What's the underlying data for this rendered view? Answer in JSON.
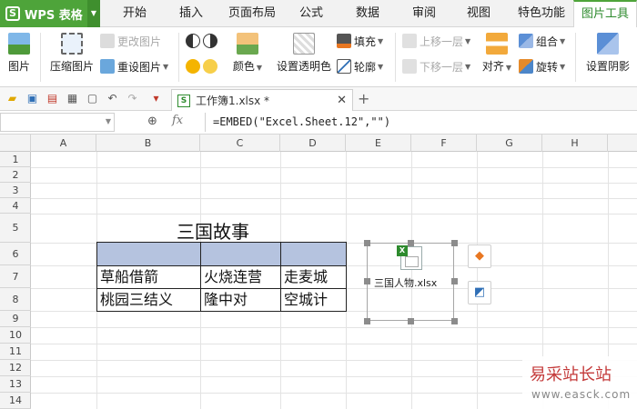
{
  "app": {
    "name": "WPS 表格"
  },
  "ribbon_tabs": [
    {
      "label": "开始"
    },
    {
      "label": "插入"
    },
    {
      "label": "页面布局"
    },
    {
      "label": "公式"
    },
    {
      "label": "数据"
    },
    {
      "label": "审阅"
    },
    {
      "label": "视图"
    },
    {
      "label": "特色功能"
    },
    {
      "label": "图片工具",
      "active": true
    }
  ],
  "ribbon": {
    "picture": "图片",
    "compress": "压缩图片",
    "change_picture": "更改图片",
    "reset_picture": "重设图片",
    "color": "颜色",
    "set_transparent": "设置透明色",
    "fill": "填充",
    "outline": "轮廓",
    "bring_forward": "上移一层",
    "send_backward": "下移一层",
    "align": "对齐",
    "group": "组合",
    "rotate": "旋转",
    "shadow": "设置阴影"
  },
  "document_tab": {
    "name": "工作簿1.xlsx *"
  },
  "formula_bar": {
    "name_box": "",
    "fx": "fx",
    "formula": "=EMBED(\"Excel.Sheet.12\",\"\")"
  },
  "columns": [
    "A",
    "B",
    "C",
    "D",
    "E",
    "F",
    "G",
    "H"
  ],
  "rows": [
    "1",
    "2",
    "3",
    "4",
    "5",
    "6",
    "7",
    "8",
    "9",
    "10",
    "11",
    "12",
    "13",
    "14"
  ],
  "sheet": {
    "title": "三国故事",
    "table_rows": [
      [
        "草船借箭",
        "火烧连营",
        "走麦城"
      ],
      [
        "桃园三结义",
        "隆中对",
        "空城计"
      ]
    ],
    "header_fill": "#b5c3df"
  },
  "embedded_object": {
    "file_name": "三国人物.xlsx"
  },
  "watermark": {
    "text": "易采站长站",
    "url": "www.easck.com"
  },
  "colors": {
    "accent": "#4ea43a",
    "active_tab_text": "#2e8b2e"
  }
}
